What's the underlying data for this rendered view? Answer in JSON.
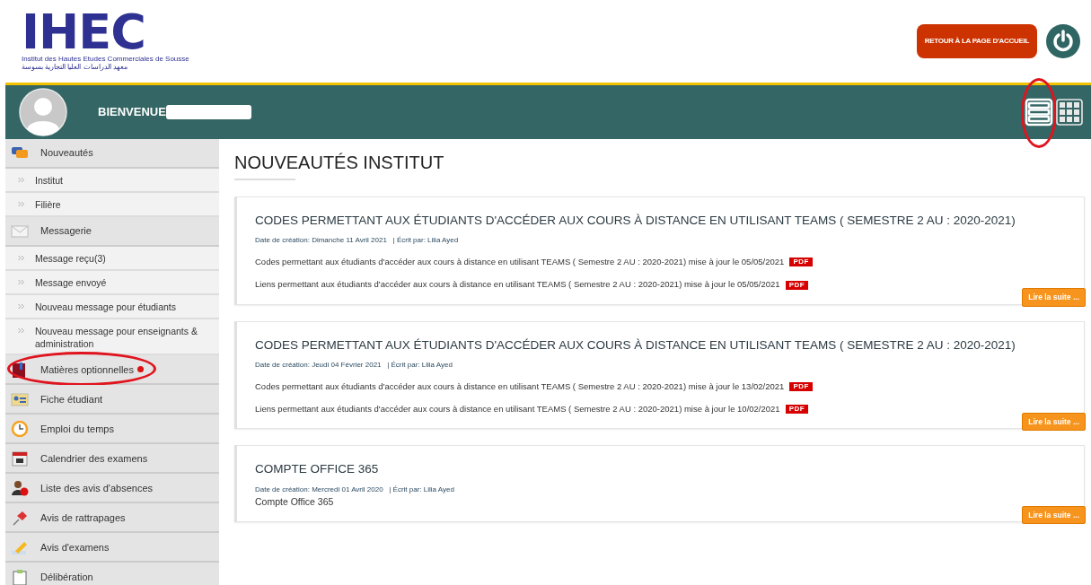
{
  "header": {
    "logo_text": "IHEC",
    "logo_subtitle": "Institut des Hautes Etudes Commerciales de Sousse",
    "logo_subtitle_ar": "معهد الدراسات العليا التجارية بسوسة",
    "home_button": "RETOUR À LA PAGE D'ACCUEIL"
  },
  "welcome_bar": {
    "greeting": "BIENVENUE",
    "name_redacted": true,
    "view_toggles": [
      {
        "kind": "list",
        "selected": true,
        "circled": true
      },
      {
        "kind": "grid",
        "selected": false,
        "circled": false
      }
    ]
  },
  "sidebar": {
    "items": [
      {
        "kind": "section",
        "label": "Nouveautés",
        "circled": false,
        "badge": false
      },
      {
        "kind": "link",
        "label": "Institut",
        "circled": false,
        "badge": false
      },
      {
        "kind": "link",
        "label": "Filière",
        "circled": false,
        "badge": false
      },
      {
        "kind": "section",
        "label": "Messagerie",
        "circled": false,
        "badge": false
      },
      {
        "kind": "link",
        "label": "Message reçu(3)",
        "circled": false,
        "badge": false
      },
      {
        "kind": "link",
        "label": "Message envoyé",
        "circled": false,
        "badge": false
      },
      {
        "kind": "link",
        "label": "Nouveau message pour étudiants",
        "circled": false,
        "badge": false
      },
      {
        "kind": "link",
        "label": "Nouveau message pour enseignants & administration",
        "circled": false,
        "badge": false
      },
      {
        "kind": "section",
        "label": "Matières optionnelles",
        "circled": true,
        "badge": true
      },
      {
        "kind": "section",
        "label": "Fiche étudiant",
        "circled": false,
        "badge": false
      },
      {
        "kind": "section",
        "label": "Emploi du temps",
        "circled": false,
        "badge": false
      },
      {
        "kind": "section",
        "label": "Calendrier des examens",
        "circled": false,
        "badge": false
      },
      {
        "kind": "section",
        "label": "Liste des avis d'absences",
        "circled": false,
        "badge": false
      },
      {
        "kind": "section",
        "label": "Avis de rattrapages",
        "circled": false,
        "badge": false
      },
      {
        "kind": "section",
        "label": "Avis d'examens",
        "circled": false,
        "badge": false
      },
      {
        "kind": "section",
        "label": "Délibération",
        "circled": false,
        "badge": false
      }
    ]
  },
  "content": {
    "title": "NOUVEAUTÉS INSTITUT",
    "posts": [
      {
        "title": "CODES PERMETTANT AUX ÉTUDIANTS D'ACCÉDER AUX COURS À DISTANCE EN UTILISANT TEAMS ( SEMESTRE 2 AU : 2020-2021)",
        "meta": "Date de création: Dimanche 11 Avril 2021",
        "author": "| Écrit par: Lilia Ayed",
        "lines": [
          {
            "text": "Codes permettant aux étudiants d'accéder aux cours à distance en utilisant TEAMS ( Semestre 2 AU : 2020-2021) mise à jour le 05/05/2021",
            "pdf": "PDF"
          },
          {
            "text": "Liens permettant aux étudiants d'accéder aux cours à distance en utilisant TEAMS ( Semestre 2 AU : 2020-2021) mise à jour le 05/05/2021",
            "pdf": "PDF"
          }
        ],
        "button": "Lire la suite ..."
      },
      {
        "title": "CODES PERMETTANT AUX ÉTUDIANTS D'ACCÉDER AUX COURS À DISTANCE EN UTILISANT TEAMS ( SEMESTRE 2 AU : 2020-2021)",
        "meta": "Date de création: Jeudi 04 Février 2021",
        "author": "| Écrit par: Lilia Ayed",
        "lines": [
          {
            "text": "Codes permettant aux étudiants d'accéder aux cours à distance en utilisant TEAMS ( Semestre 2 AU : 2020-2021) mise à jour le 13/02/2021",
            "pdf": "PDF"
          },
          {
            "text": "Liens permettant aux étudiants d'accéder aux cours à distance en utilisant TEAMS ( Semestre 2 AU : 2020-2021) mise à jour le 10/02/2021",
            "pdf": "PDF"
          }
        ],
        "button": "Lire la suite ..."
      },
      {
        "title": "COMPTE OFFICE 365",
        "meta": "Date de création: Mercredi 01 Avril 2020",
        "author": "| Écrit par: Lilia Ayed",
        "body": "Compte Office 365",
        "button": "Lire la suite ..."
      }
    ]
  }
}
